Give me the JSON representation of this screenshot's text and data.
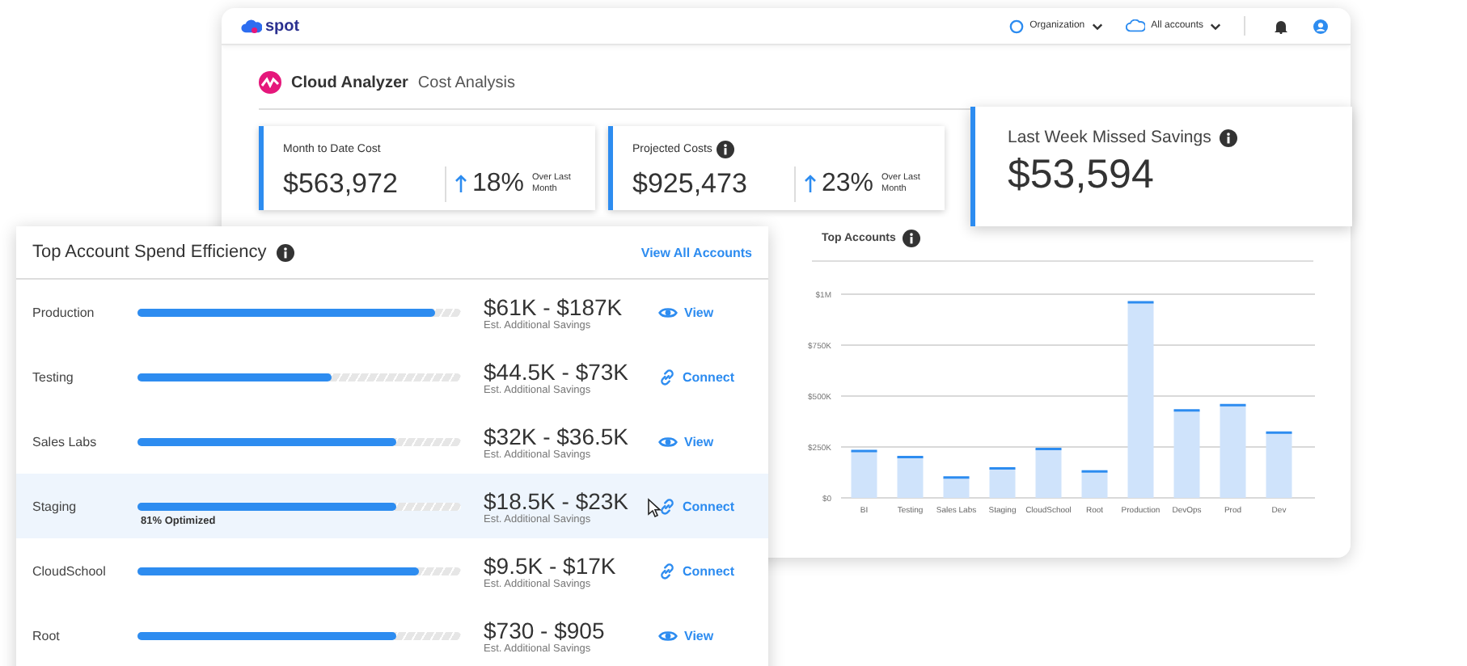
{
  "topbar": {
    "logo": "spot",
    "org_menu": "Organization",
    "accounts_menu": "All accounts"
  },
  "header": {
    "product": "Cloud Analyzer",
    "page": "Cost Analysis"
  },
  "kpis": [
    {
      "label": "Month to Date Cost",
      "info": false,
      "value": "$563,972",
      "change": "18%",
      "change_note": "Over Last Month"
    },
    {
      "label": "Projected Costs",
      "info": true,
      "value": "$925,473",
      "change": "23%",
      "change_note": "Over Last Month"
    }
  ],
  "missed_savings": {
    "label": "Last Week Missed Savings",
    "value": "$53,594"
  },
  "top_accounts": {
    "title": "Top Accounts",
    "chart_data": {
      "type": "bar",
      "categories": [
        "BI",
        "Testing",
        "Sales Labs",
        "Staging",
        "CloudSchool",
        "Root",
        "Production",
        "DevOps",
        "Prod",
        "Dev"
      ],
      "grid": true,
      "series": [
        {
          "color": "#cfe3fb",
          "values": [
            230000,
            200000,
            100000,
            145000,
            240000,
            130000,
            960000,
            430000,
            455000,
            320000
          ]
        }
      ],
      "ylim": [
        0,
        1000000
      ],
      "yticks": [
        {
          "value": 0,
          "label": "$0"
        },
        {
          "value": 250000,
          "label": "$250K"
        },
        {
          "value": 500000,
          "label": "$500K"
        },
        {
          "value": 750000,
          "label": "$750K"
        },
        {
          "value": 1000000,
          "label": "$1M"
        }
      ]
    }
  },
  "efficiency": {
    "title": "Top Account Spend Efficiency",
    "link": "View All Accounts",
    "rows": [
      {
        "name": "Production",
        "level": 0.92,
        "savings": "$61K - $187K",
        "savings_label": "Est. Additional Savings",
        "action": {
          "kind": "view",
          "label": "View"
        },
        "selected": false
      },
      {
        "name": "Testing",
        "level": 0.6,
        "savings": "$44.5K - $73K",
        "savings_label": "Est. Additional Savings",
        "action": {
          "kind": "connect",
          "label": "Connect"
        },
        "selected": false
      },
      {
        "name": "Sales Labs",
        "level": 0.8,
        "savings": "$32K - $36.5K",
        "savings_label": "Est. Additional Savings",
        "action": {
          "kind": "view",
          "label": "View"
        },
        "selected": false
      },
      {
        "name": "Staging",
        "level": 0.8,
        "note": "81% Optimized",
        "savings": "$18.5K - $23K",
        "savings_label": "Est. Additional Savings",
        "action": {
          "kind": "connect",
          "label": "Connect"
        },
        "selected": true
      },
      {
        "name": "CloudSchool",
        "level": 0.87,
        "savings": "$9.5K - $17K",
        "savings_label": "Est. Additional Savings",
        "action": {
          "kind": "connect",
          "label": "Connect"
        },
        "selected": false
      },
      {
        "name": "Root",
        "level": 0.8,
        "savings": "$730 - $905",
        "savings_label": "Est. Additional Savings",
        "action": {
          "kind": "view",
          "label": "View"
        },
        "selected": false
      }
    ]
  }
}
